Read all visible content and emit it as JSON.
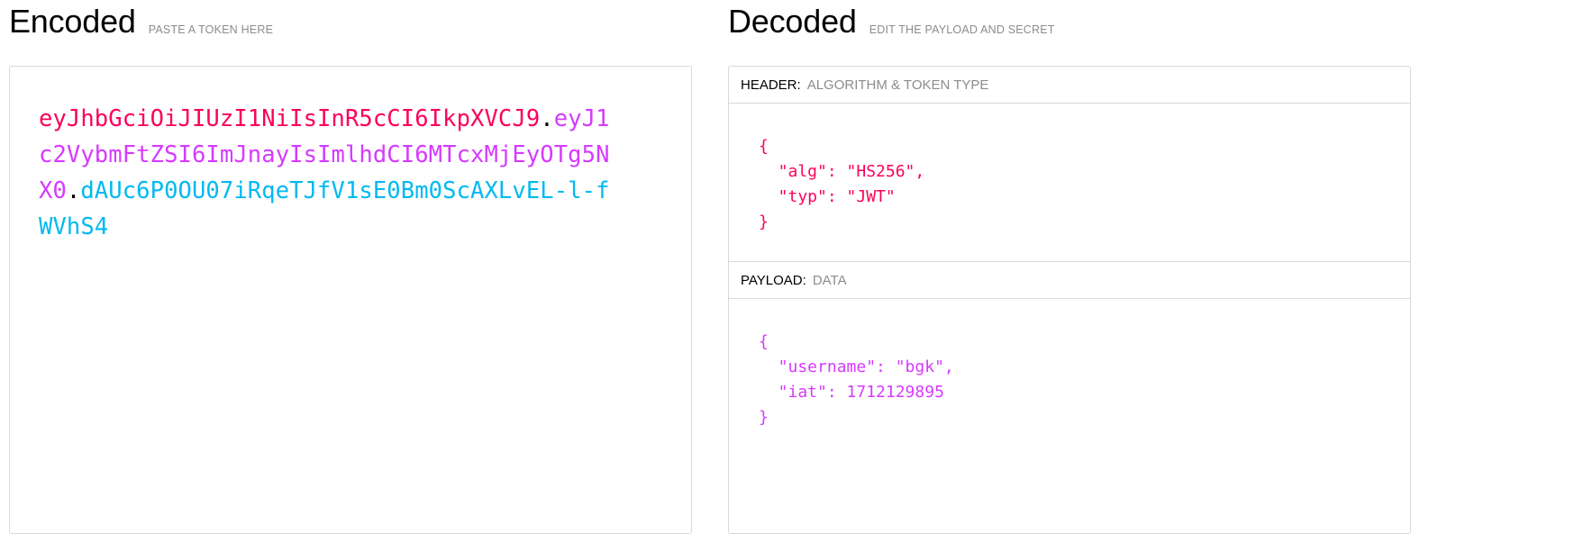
{
  "encoded": {
    "title": "Encoded",
    "subtitle": "PASTE A TOKEN HERE",
    "token": {
      "header": "eyJhbGciOiJIUzI1NiIsInR5cCI6IkpXVCJ9",
      "dot1": ".",
      "payload": "eyJ1c2VybmFtZSI6ImJnayIsImlhdCI6MTcxMjEyOTg5NX0",
      "dot2": ".",
      "signature": "dAUc6P0OU07iRqeTJfV1sE0Bm0ScAXLvEL-l-fWVhS4"
    }
  },
  "decoded": {
    "title": "Decoded",
    "subtitle": "EDIT THE PAYLOAD AND SECRET",
    "header_section": {
      "label": "HEADER:",
      "description": "ALGORITHM & TOKEN TYPE",
      "lines": [
        "{",
        "  \"alg\": \"HS256\",",
        "  \"typ\": \"JWT\"",
        "}"
      ]
    },
    "payload_section": {
      "label": "PAYLOAD:",
      "description": "DATA",
      "lines": [
        "{",
        "  \"username\": \"bgk\",",
        "  \"iat\": 1712129895",
        "}"
      ]
    }
  },
  "colors": {
    "header": "#fb015b",
    "payload": "#d63aff",
    "signature": "#00b9f1"
  }
}
